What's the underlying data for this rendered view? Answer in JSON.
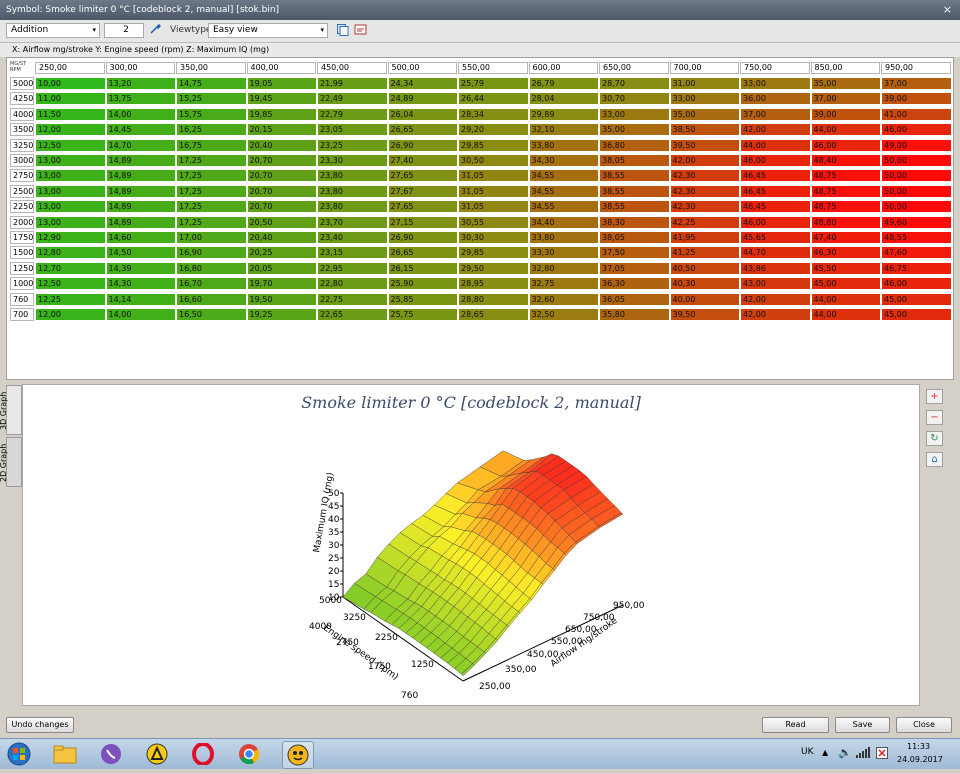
{
  "window": {
    "title": "Symbol: Smoke limiter 0 °C [codeblock 2, manual] [stok.bin]",
    "close_glyph": "×"
  },
  "toolbar": {
    "operation": "Addition",
    "operand": "2",
    "viewtype_label": "Viewtype",
    "viewtype": "Easy view",
    "combo_arrow": "▾"
  },
  "axes_line": "X: Airflow mg/stroke Y: Engine speed (rpm) Z: Maximum IQ (mg)",
  "table": {
    "corner_top": "MG/ST",
    "corner_bottom": "RPM",
    "x_headers": [
      "250,00",
      "300,00",
      "350,00",
      "400,00",
      "450,00",
      "500,00",
      "550,00",
      "600,00",
      "650,00",
      "700,00",
      "750,00",
      "850,00",
      "950,00"
    ],
    "y_headers": [
      "5000",
      "4250",
      "4000",
      "3500",
      "3250",
      "3000",
      "2750",
      "2500",
      "2250",
      "2000",
      "1750",
      "1500",
      "1250",
      "1000",
      "760",
      "700"
    ],
    "rows": [
      [
        "10,00",
        "13,20",
        "14,75",
        "19,05",
        "21,99",
        "24,34",
        "25,79",
        "26,79",
        "28,70",
        "31,00",
        "33,00",
        "35,00",
        "37,00"
      ],
      [
        "11,00",
        "13,75",
        "15,25",
        "19,45",
        "22,49",
        "24,89",
        "26,44",
        "28,04",
        "30,70",
        "33,00",
        "36,00",
        "37,00",
        "39,00"
      ],
      [
        "11,50",
        "14,00",
        "15,75",
        "19,85",
        "22,79",
        "26,04",
        "28,34",
        "29,89",
        "33,00",
        "35,00",
        "37,00",
        "39,00",
        "41,00"
      ],
      [
        "12,00",
        "14,45",
        "16,25",
        "20,15",
        "23,05",
        "26,65",
        "29,20",
        "32,10",
        "35,00",
        "38,50",
        "42,00",
        "44,00",
        "46,00"
      ],
      [
        "12,50",
        "14,70",
        "16,75",
        "20,40",
        "23,25",
        "26,90",
        "29,85",
        "33,80",
        "36,80",
        "39,50",
        "44,00",
        "46,00",
        "49,00"
      ],
      [
        "13,00",
        "14,89",
        "17,25",
        "20,70",
        "23,30",
        "27,40",
        "30,50",
        "34,30",
        "38,05",
        "42,00",
        "46,00",
        "48,40",
        "50,00"
      ],
      [
        "13,00",
        "14,89",
        "17,25",
        "20,70",
        "23,80",
        "27,65",
        "31,05",
        "34,55",
        "38,55",
        "42,30",
        "46,45",
        "48,75",
        "50,00"
      ],
      [
        "13,00",
        "14,89",
        "17,25",
        "20,70",
        "23,80",
        "27,67",
        "31,05",
        "34,55",
        "38,55",
        "42,30",
        "46,45",
        "48,75",
        "50,00"
      ],
      [
        "13,00",
        "14,89",
        "17,25",
        "20,70",
        "23,80",
        "27,65",
        "31,05",
        "34,55",
        "38,55",
        "42,30",
        "46,45",
        "48,75",
        "50,00"
      ],
      [
        "13,00",
        "14,89",
        "17,25",
        "20,50",
        "23,70",
        "27,15",
        "30,55",
        "34,40",
        "38,30",
        "42,25",
        "46,00",
        "48,80",
        "49,60"
      ],
      [
        "12,90",
        "14,60",
        "17,00",
        "20,40",
        "23,40",
        "26,90",
        "30,30",
        "33,80",
        "38,05",
        "41,95",
        "45,65",
        "47,40",
        "48,55"
      ],
      [
        "12,80",
        "14,50",
        "16,90",
        "20,25",
        "23,15",
        "26,65",
        "29,85",
        "33,30",
        "37,50",
        "41,25",
        "44,70",
        "46,30",
        "47,60"
      ],
      [
        "12,70",
        "14,39",
        "16,80",
        "20,05",
        "22,95",
        "26,15",
        "29,50",
        "32,80",
        "37,05",
        "40,50",
        "43,86",
        "45,50",
        "46,75"
      ],
      [
        "12,50",
        "14,30",
        "16,70",
        "19,70",
        "22,80",
        "25,90",
        "28,95",
        "32,75",
        "36,30",
        "40,30",
        "43,00",
        "45,00",
        "46,00"
      ],
      [
        "12,25",
        "14,14",
        "16,60",
        "19,50",
        "22,75",
        "25,85",
        "28,80",
        "32,60",
        "36,05",
        "40,00",
        "42,00",
        "44,00",
        "45,00"
      ],
      [
        "12,00",
        "14,00",
        "16,50",
        "19,25",
        "22,65",
        "25,75",
        "28,65",
        "32,50",
        "35,80",
        "39,50",
        "42,00",
        "44,00",
        "45,00"
      ]
    ]
  },
  "graph": {
    "title": "Smoke limiter 0 °C [codeblock 2, manual]",
    "tabs": [
      "3D Graph",
      "2D Graph"
    ],
    "z_axis_label": "Maximum IQ (mg)",
    "y_axis_label": "Engine speed (rpm)",
    "x_axis_label": "Airflow mg/stroke",
    "z_ticks": [
      "50",
      "45",
      "40",
      "35",
      "30",
      "25",
      "20",
      "15",
      "10"
    ],
    "y_ticks": [
      "5000",
      "4000",
      "3250",
      "2750",
      "2250",
      "1750",
      "1250",
      "760"
    ],
    "x_ticks": [
      "950,00",
      "750,00",
      "650,00",
      "550,00",
      "450,00",
      "350,00",
      "250,00"
    ],
    "tools": [
      "zoom-in",
      "zoom-out",
      "rotate",
      "reset"
    ]
  },
  "buttons": {
    "undo": "Undo changes",
    "read": "Read",
    "save": "Save",
    "close": "Close"
  },
  "taskbar": {
    "language": "UK",
    "time": "11:33",
    "date": "24.09.2017"
  },
  "colors": {
    "low": "#2fb81b",
    "mid": "#8c8c12",
    "high": "#ff0a0a"
  }
}
